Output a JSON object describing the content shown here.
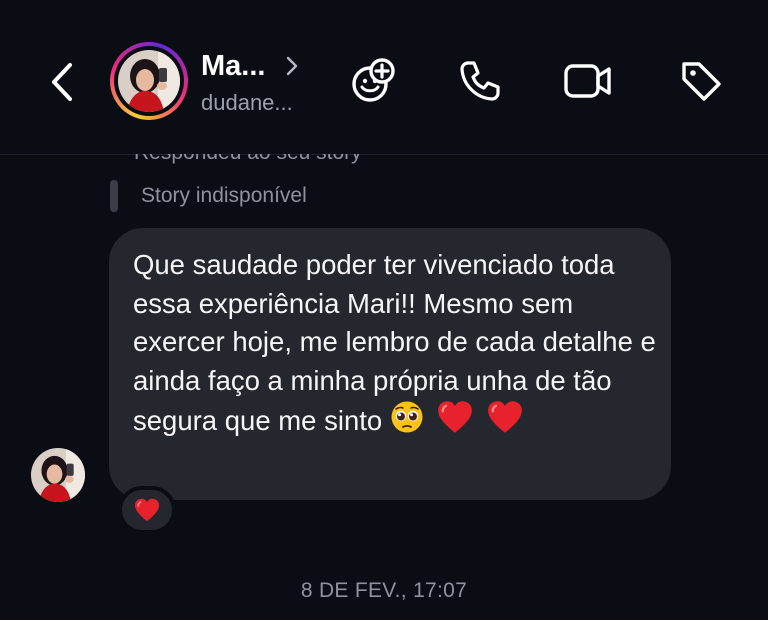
{
  "header": {
    "name": "Ma...",
    "username": "dudane...",
    "icons": [
      "back-icon",
      "avatar",
      "chevron-right-icon",
      "add-sticker-icon",
      "phone-icon",
      "video-camera-icon",
      "tag-icon"
    ]
  },
  "story_reply": {
    "label": "Respondeu ao seu story",
    "status": "Story indisponível"
  },
  "message": {
    "text": "Que saudade poder ter vivenciado toda essa experiência Mari!! Mesmo sem exercer hoje, me lembro de cada detalhe e ainda faço a minha própria unha de tão segura que me sinto",
    "emojis": [
      "pleading-face-emoji",
      "red-heart-emoji",
      "red-heart-emoji"
    ],
    "reaction": "red-heart-emoji"
  },
  "timestamp": "8 DE FEV., 17:07",
  "colors": {
    "background": "#0b0d15",
    "bubble": "#25272e",
    "secondary_text": "#8e929c",
    "heart": "#e8222c"
  }
}
